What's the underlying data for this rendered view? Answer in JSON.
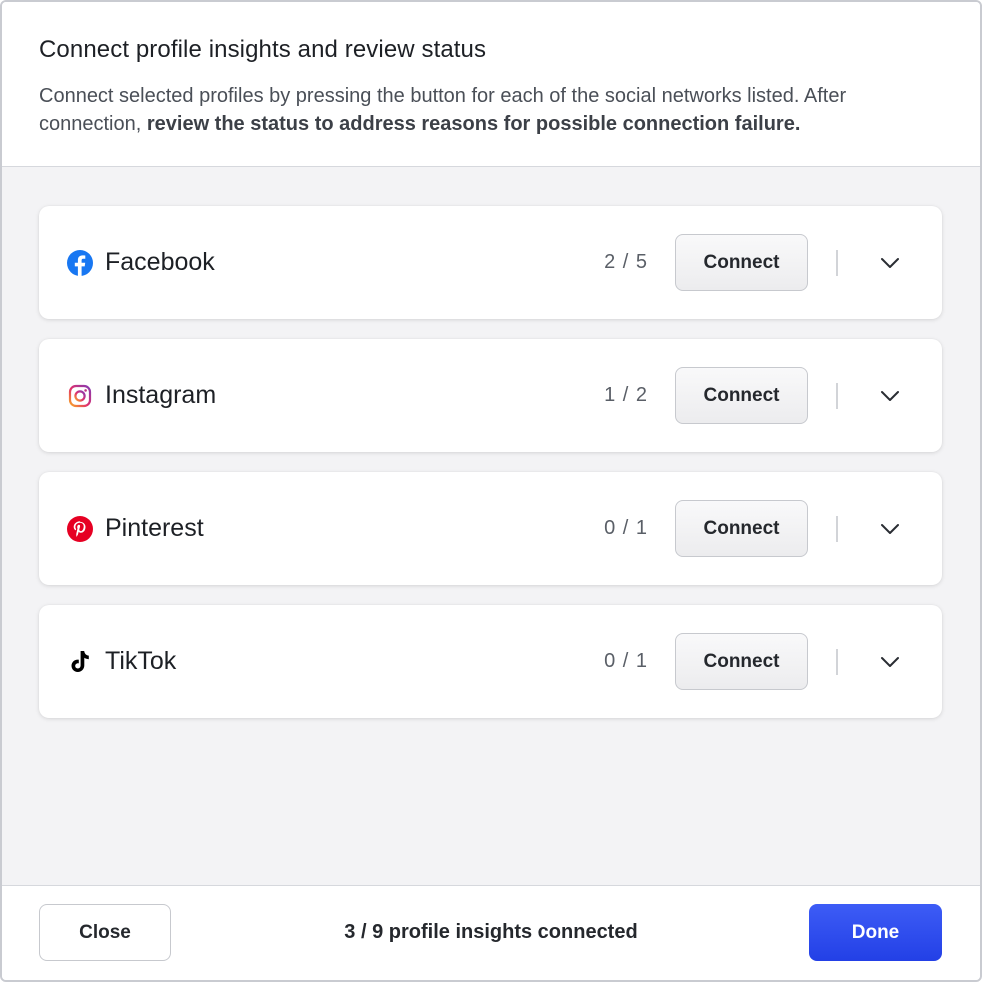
{
  "dialog": {
    "title": "Connect profile insights and review status",
    "description_plain": "Connect selected profiles by pressing the button for each of the social networks listed. After connection, ",
    "description_bold": "review the status to address reasons for possible connection failure."
  },
  "networks": [
    {
      "name": "Facebook",
      "count": "2 / 5",
      "connect_label": "Connect",
      "icon": "facebook-icon",
      "color": "#1877f2"
    },
    {
      "name": "Instagram",
      "count": "1 / 2",
      "connect_label": "Connect",
      "icon": "instagram-icon",
      "color": "#e1306c"
    },
    {
      "name": "Pinterest",
      "count": "0 / 1",
      "connect_label": "Connect",
      "icon": "pinterest-icon",
      "color": "#e60023"
    },
    {
      "name": "TikTok",
      "count": "0 / 1",
      "connect_label": "Connect",
      "icon": "tiktok-icon",
      "color": "#000000"
    }
  ],
  "footer": {
    "close_label": "Close",
    "status_text": "3 / 9 profile insights connected",
    "done_label": "Done"
  },
  "colors": {
    "primary": "#2f4ef0",
    "panel_bg": "#f3f3f5"
  }
}
